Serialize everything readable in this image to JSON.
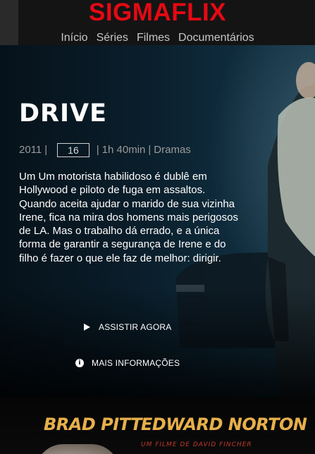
{
  "header": {
    "logo": "SIGMAFLIX",
    "nav": [
      "Início",
      "Séries",
      "Filmes",
      "Documentários"
    ]
  },
  "hero": {
    "title": "DRIVE",
    "year": "2011",
    "age_rating": "16",
    "duration": "1h 40min",
    "genre": "Dramas",
    "synopsis": "Um Um motorista habilidoso é dublê em Hollywood e piloto de fuga em assaltos. Quando aceita ajudar o marido de sua vizinha Irene, fica na mira dos homens mais perigosos de LA. Mas o trabalho dá errado, e a única forma de garantir a segurança de Irene e do filho é fazer o que ele faz de melhor: dirigir.",
    "watch_label": "ASSISTIR AGORA",
    "info_label": "MAIS INFORMAÇÕES",
    "meta_separator": "|"
  },
  "poster": {
    "actor1": "Brad Pitt",
    "actor2": "Edward Norton",
    "director_line": "Um filme de David Fincher"
  },
  "colors": {
    "logo": "#e50914",
    "background": "#0b0b0b",
    "poster_text": "#e7b04a"
  },
  "icons": {
    "play": "play-icon",
    "info": "info-icon"
  }
}
